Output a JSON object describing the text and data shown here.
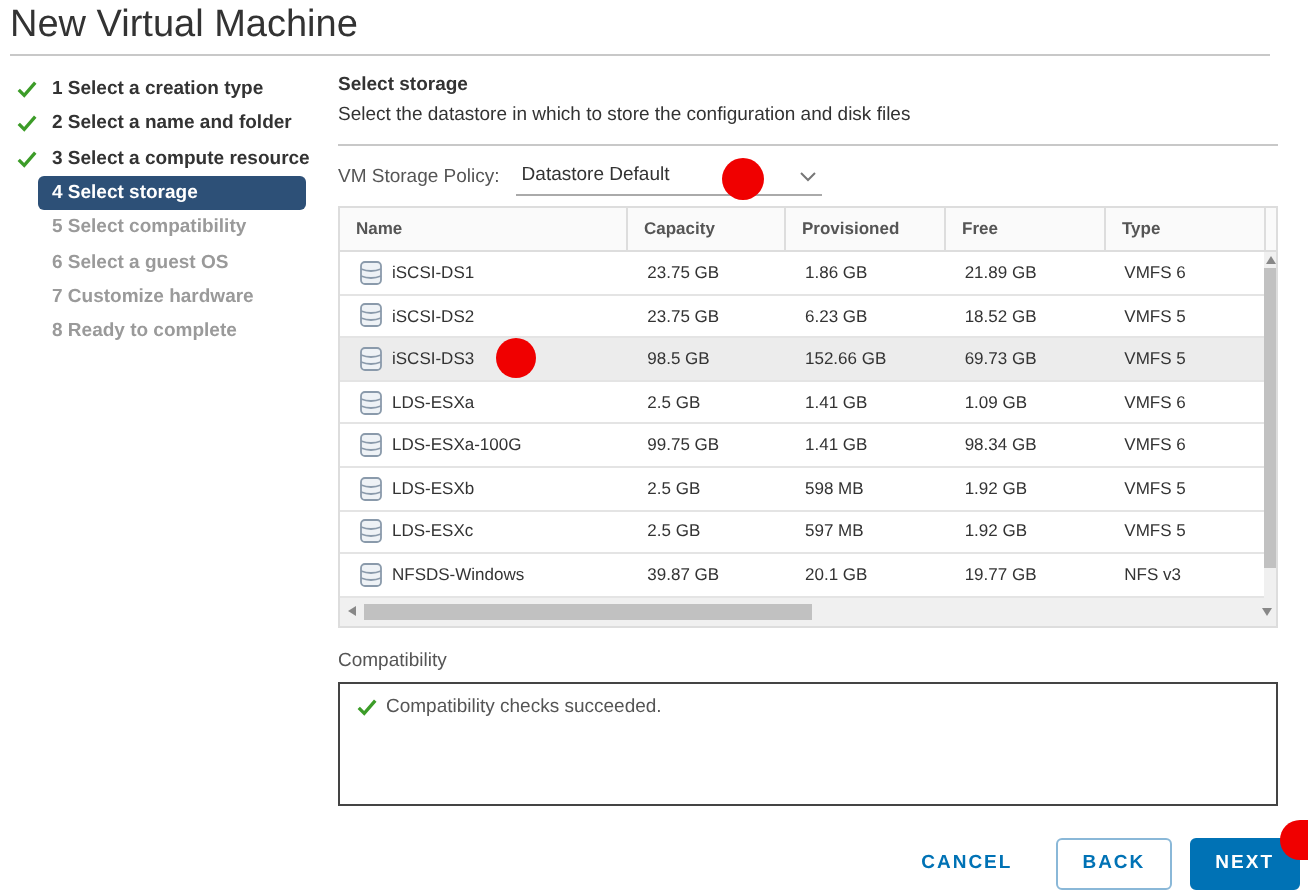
{
  "window": {
    "title": "New Virtual Machine"
  },
  "steps": [
    {
      "label": "1 Select a creation type",
      "completed": true,
      "selected": false
    },
    {
      "label": "2 Select a name and folder",
      "completed": true,
      "selected": false
    },
    {
      "label": "3 Select a compute resource",
      "completed": true,
      "selected": false
    },
    {
      "label": "4 Select storage",
      "completed": false,
      "selected": true
    },
    {
      "label": "5 Select compatibility",
      "completed": false,
      "selected": false
    },
    {
      "label": "6 Select a guest OS",
      "completed": false,
      "selected": false
    },
    {
      "label": "7 Customize hardware",
      "completed": false,
      "selected": false
    },
    {
      "label": "8 Ready to complete",
      "completed": false,
      "selected": false
    }
  ],
  "section": {
    "title": "Select storage",
    "description": "Select the datastore in which to store the configuration and disk files"
  },
  "policy": {
    "label": "VM Storage Policy:",
    "value": "Datastore Default"
  },
  "table": {
    "columns": [
      "Name",
      "Capacity",
      "Provisioned",
      "Free",
      "Type"
    ],
    "rows": [
      {
        "cells": [
          "iSCSI-DS1",
          "23.75 GB",
          "1.86 GB",
          "21.89 GB",
          "VMFS 6"
        ],
        "selected": false
      },
      {
        "cells": [
          "iSCSI-DS2",
          "23.75 GB",
          "6.23 GB",
          "18.52 GB",
          "VMFS 5"
        ],
        "selected": false
      },
      {
        "cells": [
          "iSCSI-DS3",
          "98.5 GB",
          "152.66 GB",
          "69.73 GB",
          "VMFS 5"
        ],
        "selected": true
      },
      {
        "cells": [
          "LDS-ESXa",
          "2.5 GB",
          "1.41 GB",
          "1.09 GB",
          "VMFS 6"
        ],
        "selected": false
      },
      {
        "cells": [
          "LDS-ESXa-100G",
          "99.75 GB",
          "1.41 GB",
          "98.34 GB",
          "VMFS 6"
        ],
        "selected": false
      },
      {
        "cells": [
          "LDS-ESXb",
          "2.5 GB",
          "598 MB",
          "1.92 GB",
          "VMFS 5"
        ],
        "selected": false
      },
      {
        "cells": [
          "LDS-ESXc",
          "2.5 GB",
          "597 MB",
          "1.92 GB",
          "VMFS 5"
        ],
        "selected": false
      },
      {
        "cells": [
          "NFSDS-Windows",
          "39.87 GB",
          "20.1 GB",
          "19.77 GB",
          "NFS v3"
        ],
        "selected": false
      }
    ]
  },
  "compatibility": {
    "label": "Compatibility",
    "message": "Compatibility checks succeeded.",
    "passed": true
  },
  "buttons": [
    {
      "label": "CANCEL",
      "kind": "link"
    },
    {
      "label": "BACK",
      "kind": "outline"
    },
    {
      "label": "NEXT",
      "kind": "primary"
    }
  ]
}
